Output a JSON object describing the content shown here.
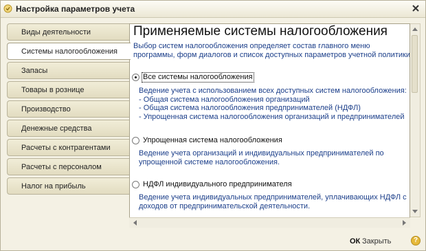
{
  "window": {
    "title": "Настройка параметров учета"
  },
  "tabs": [
    {
      "label": "Виды деятельности"
    },
    {
      "label": "Системы налогообложения"
    },
    {
      "label": "Запасы"
    },
    {
      "label": "Товары в рознице"
    },
    {
      "label": "Производство"
    },
    {
      "label": "Денежные средства"
    },
    {
      "label": "Расчеты с контрагентами"
    },
    {
      "label": "Расчеты с персоналом"
    },
    {
      "label": "Налог на прибыль"
    }
  ],
  "panel": {
    "heading": "Применяемые системы налогообложения",
    "description": [
      "Выбор систем налогообложения определяет состав главного меню",
      "программы, форм диалогов и список доступных параметров учетной политики"
    ],
    "options": [
      {
        "label": "Все системы налогообложения",
        "selected": true,
        "description": [
          "Ведение учета с использованием всех доступных систем налогообложения:",
          "- Общая система налогообложения организаций",
          "- Общая система налогообложения предпринимателей (НДФЛ)",
          "- Упрощенная система налогообложения организаций и предпринимателей"
        ]
      },
      {
        "label": "Упрощенная система налогообложения",
        "selected": false,
        "description": [
          "Ведение учета организаций и индивидуальных предпринимателей по",
          "упрощенной системе налогообложения."
        ]
      },
      {
        "label": "НДФЛ индивидуального предпринимателя",
        "selected": false,
        "description": [
          "Ведение учета индивидуальных предпринимателей, уплачивающих НДФЛ с",
          "доходов от предпринимательской деятельности."
        ]
      }
    ]
  },
  "footer": {
    "ok_label": "ОК",
    "close_label": "Закрыть",
    "help_label": "?"
  },
  "colors": {
    "description_text": "#1c3f8a",
    "window_bg": "#f4f1e4",
    "help_icon": "#e6b93a"
  }
}
